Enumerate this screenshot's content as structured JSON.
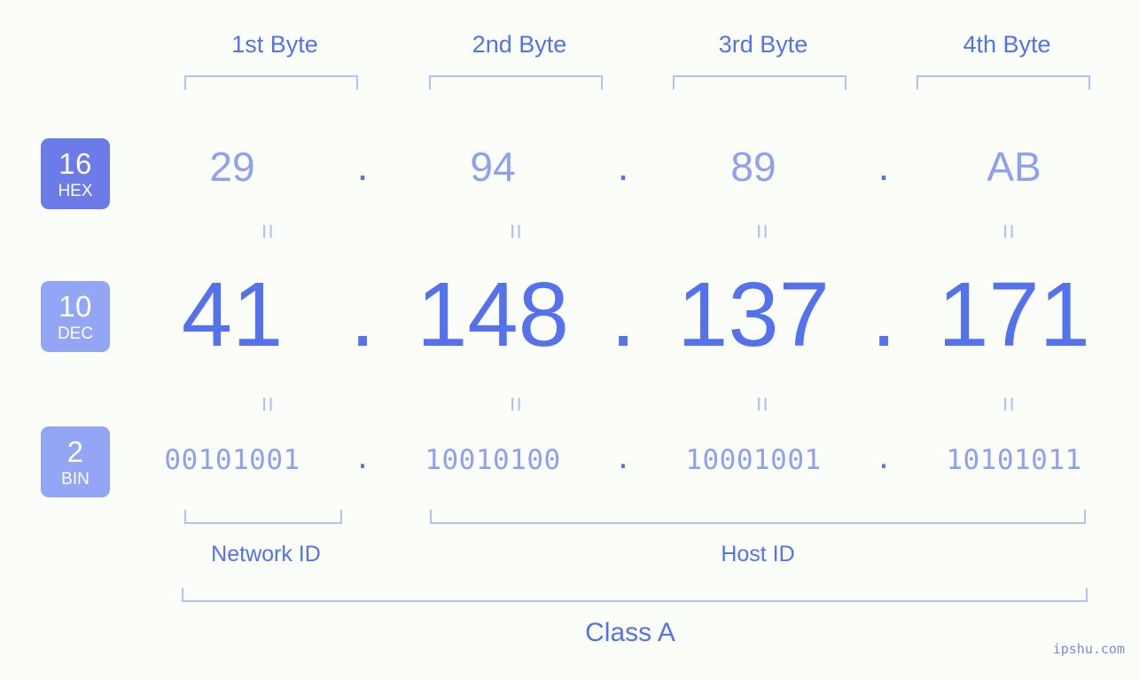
{
  "bytes": [
    {
      "label": "1st Byte"
    },
    {
      "label": "2nd Byte"
    },
    {
      "label": "3rd Byte"
    },
    {
      "label": "4th Byte"
    }
  ],
  "bases": [
    {
      "number": "16",
      "name": "HEX",
      "color": "#6b7ce8"
    },
    {
      "number": "10",
      "name": "DEC",
      "color": "#93a6f5"
    },
    {
      "number": "2",
      "name": "BIN",
      "color": "#93a6f5"
    }
  ],
  "hex": {
    "o1": "29",
    "o2": "94",
    "o3": "89",
    "o4": "AB"
  },
  "dec": {
    "o1": "41",
    "o2": "148",
    "o3": "137",
    "o4": "171"
  },
  "bin": {
    "o1": "00101001",
    "o2": "10010100",
    "o3": "10001001",
    "o4": "10101011"
  },
  "separator": ".",
  "equals": "=",
  "sections": {
    "network_id": "Network ID",
    "host_id": "Host ID",
    "class": "Class A"
  },
  "watermark": "ipshu.com",
  "colors": {
    "background": "#fbfdf8",
    "accent_strong": "#5472ec",
    "accent_light": "#8fa0f0",
    "line": "#b4c0fc",
    "badge_dark": "#6b7ce8",
    "badge_light": "#93a6f5"
  }
}
